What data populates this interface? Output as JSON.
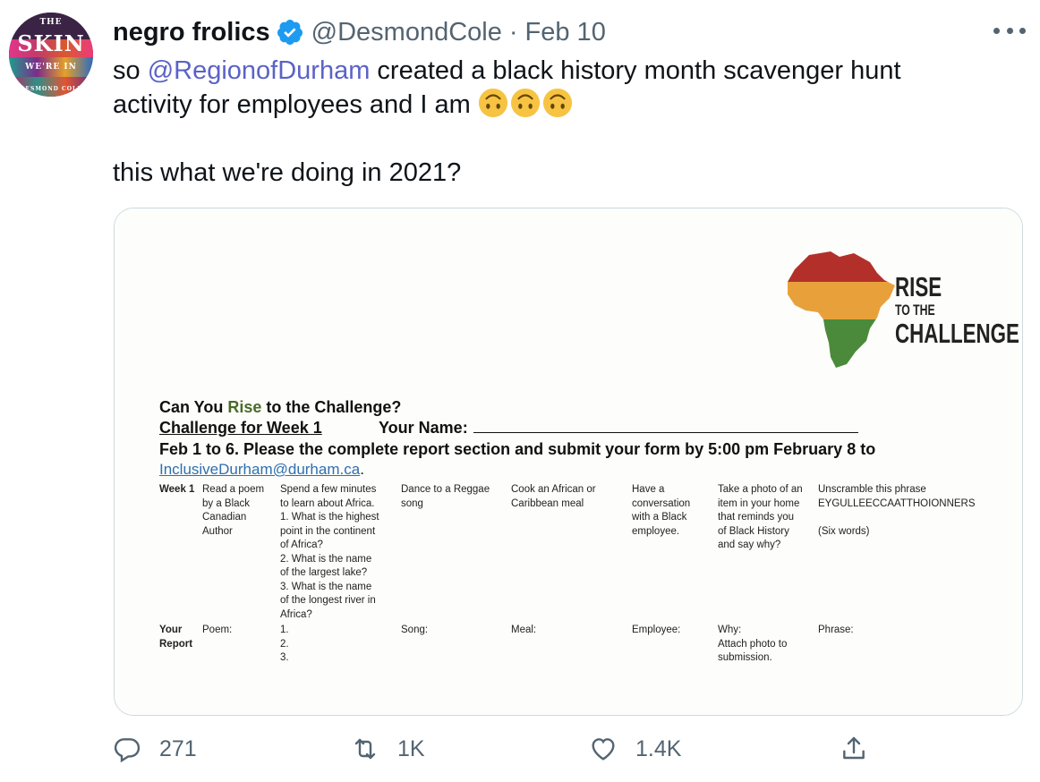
{
  "author": {
    "display_name": "negro frolics",
    "handle": "@DesmondCole",
    "separator": "·",
    "date": "Feb 10",
    "avatar": {
      "title_top": "THE",
      "title_main": "SKIN",
      "title_sub": "WE'RE IN",
      "author_name": "DESMOND COLE"
    }
  },
  "tweet": {
    "line1_prefix": "so ",
    "mention": "@RegionofDurham",
    "line1_suffix": " created a black history month  scavenger hunt",
    "line2": "activity for employees and I am ",
    "emoji": "upside-down-face",
    "line3": "this what we're doing in 2021?"
  },
  "document": {
    "logo": {
      "word1": "RISE",
      "word2": "TO THE",
      "word3": "CHALLENGE",
      "colors": [
        "#b3302a",
        "#e8a13a",
        "#4b8a3a"
      ]
    },
    "title_prefix": "Can You ",
    "title_rise": "Rise",
    "title_suffix": " to the Challenge?",
    "week_heading": "Challenge for Week 1",
    "your_name_label": "Your Name:",
    "instructions": "Feb 1 to 6. Please the complete report section and submit your form by 5:00 pm February 8 to",
    "email": "InclusiveDurham@durham.ca",
    "email_suffix": ".",
    "table": {
      "week_label": "Week 1",
      "report_label": "Your\nReport",
      "tasks": [
        "Read a poem\nby a Black\nCanadian\nAuthor",
        "Spend a few minutes\nto learn about Africa.\n1. What is the highest\npoint in the continent\nof Africa?\n2. What is the name\nof the largest lake?\n3. What is the name\nof the longest river in\nAfrica?",
        "Dance to a Reggae\nsong",
        "Cook an African or\nCaribbean meal",
        "Have a\nconversation\nwith a Black\nemployee.",
        "Take a photo of an\nitem in your home\nthat reminds you\nof Black History\nand say why?",
        "Unscramble this phrase\nEYGULLEECCAATTHOIONNERS\n\n(Six words)"
      ],
      "reports": [
        "Poem:",
        "1.\n2.\n3.",
        "Song:",
        "Meal:",
        "Employee:",
        "Why:\nAttach photo to\nsubmission.",
        "Phrase:"
      ]
    }
  },
  "actions": {
    "reply_count": "271",
    "retweet_count": "1K",
    "like_count": "1.4K"
  },
  "colors": {
    "link": "#5b62c7",
    "secondary": "#536471",
    "verified": "#1d9bf0"
  }
}
